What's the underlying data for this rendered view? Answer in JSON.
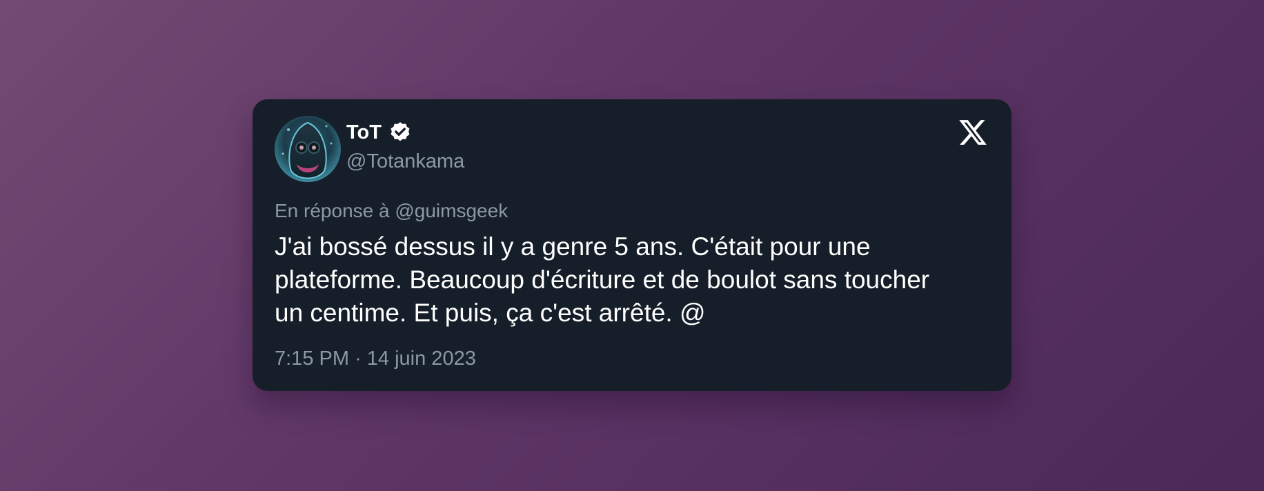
{
  "tweet": {
    "display_name": "ToT",
    "handle": "@Totankama",
    "verified": true,
    "reply_prefix": "En réponse à",
    "reply_to": "@guimsgeek",
    "body_lines": [
      "J'ai bossé dessus il y a genre 5 ans. C'était pour une",
      "plateforme. Beaucoup d'écriture et de boulot sans toucher",
      "un centime. Et puis, ça c'est arrêté. @"
    ],
    "time": "7:15 PM",
    "separator": "·",
    "date": "14 juin 2023"
  },
  "icons": {
    "avatar": "avatar-image",
    "verified": "verified-badge-icon",
    "platform": "x-logo-icon"
  },
  "colors": {
    "card_background": "#161f29",
    "primary_text": "#ffffff",
    "secondary_text": "#8b98a5",
    "page_gradient_start": "#724a72",
    "page_gradient_end": "#4a2858"
  }
}
